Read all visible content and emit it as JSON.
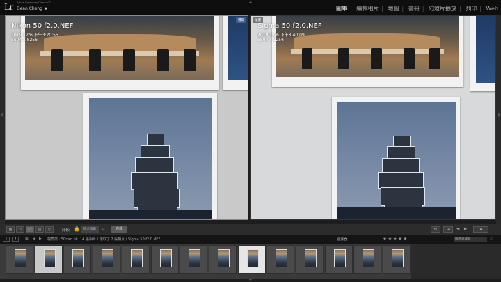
{
  "app": {
    "logo": "Lr",
    "product": "Adobe Lightroom Classic CC",
    "user": "Dean Cheng",
    "modules": [
      "圖庫",
      "編輯相片",
      "地圖",
      "書冊",
      "幻燈片播放",
      "列印",
      "Web"
    ],
    "active_module": "圖庫"
  },
  "compare": {
    "left": {
      "filename": "Nikon 50 f2.0.NEF",
      "datetime": "2019/12/6 下午3:20:55",
      "dimensions": "5504 x 8256",
      "badge": "選取"
    },
    "right": {
      "filename": "Sigma 50 f2.0.NEF",
      "datetime": "2019/12/6 下午3:40:09",
      "dimensions": "5504 x 8256",
      "badge": "候選"
    }
  },
  "toolbar": {
    "compare_label": "比較",
    "zoom_select": "適合螢幕",
    "done_label": "完成"
  },
  "status": {
    "page_numbers": [
      "1",
      "2"
    ],
    "path": "檔案夾 : 50mm pk",
    "info": "14 張相片 / 選取了 2 張相片 / Sigma 50 f2.0.NEF",
    "filter_label": "過濾器 :",
    "filter_value": "關閉過濾器",
    "stars": "★★★★★"
  },
  "filmstrip": {
    "count": 14,
    "selected_indices": [
      1,
      8
    ],
    "active_index": 8
  },
  "colors": {
    "accent": "#3b5b8a",
    "background": "#1d1d1d"
  }
}
